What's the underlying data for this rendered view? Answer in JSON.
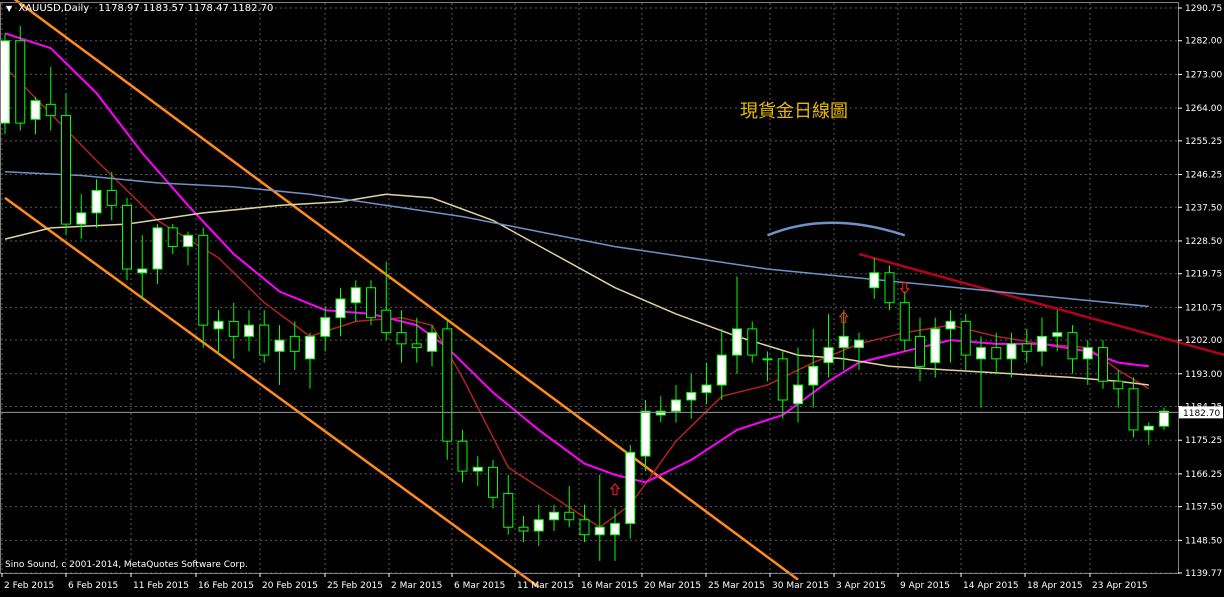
{
  "header": {
    "symbol": "XAUUSD,Daily",
    "ohlc": "1178.97 1183.57 1178.47 1182.70"
  },
  "annotation_title": "現貨金日線圖",
  "copyright": "Sino Sound, c 2001-2014, MetaQuotes Software Corp.",
  "colors": {
    "background": "#000000",
    "grid": "#5a5a5a",
    "axis_text": "#ffffff",
    "bull_candle": "#ffffff",
    "candle_outline": "#00ff00",
    "ma_fast": "#b22222",
    "ma_mid": "#ff00ff",
    "ma_slow": "#e0d4a0",
    "ma_long": "#6f93c8",
    "channel": "#ff8c1a",
    "resistance": "#b3001b",
    "arc": "#6f93c8",
    "arrow": "#ff2020",
    "title_text": "#e6b800"
  },
  "chart_data": {
    "type": "candlestick",
    "symbol": "XAUUSD",
    "timeframe": "Daily",
    "ylim": [
      1139.77,
      1290.75
    ],
    "y_ticks": [
      "1290.75",
      "1282.00",
      "1273.00",
      "1264.00",
      "1255.25",
      "1246.25",
      "1237.50",
      "1228.50",
      "1219.75",
      "1210.75",
      "1202.00",
      "1193.00",
      "1184.25",
      "1175.25",
      "1166.25",
      "1157.50",
      "1148.50",
      "1139.77"
    ],
    "x_tick_labels": [
      "2 Feb 2015",
      "6 Feb 2015",
      "11 Feb 2015",
      "16 Feb 2015",
      "20 Feb 2015",
      "25 Feb 2015",
      "2 Mar 2015",
      "6 Mar 2015",
      "11 Mar 2015",
      "16 Mar 2015",
      "20 Mar 2015",
      "25 Mar 2015",
      "30 Mar 2015",
      "3 Apr 2015",
      "9 Apr 2015",
      "14 Apr 2015",
      "18 Apr 2015",
      "23 Apr 2015"
    ],
    "current_price": "1182.70",
    "candles": [
      {
        "o": 1260,
        "h": 1284,
        "l": 1257,
        "c": 1282
      },
      {
        "o": 1282,
        "h": 1286,
        "l": 1258,
        "c": 1260
      },
      {
        "o": 1261,
        "h": 1267,
        "l": 1257,
        "c": 1266
      },
      {
        "o": 1265,
        "h": 1275,
        "l": 1258,
        "c": 1262
      },
      {
        "o": 1262,
        "h": 1268,
        "l": 1230,
        "c": 1233
      },
      {
        "o": 1233,
        "h": 1241,
        "l": 1229,
        "c": 1236
      },
      {
        "o": 1236,
        "h": 1245,
        "l": 1232,
        "c": 1242
      },
      {
        "o": 1242,
        "h": 1247,
        "l": 1234,
        "c": 1238
      },
      {
        "o": 1238,
        "h": 1240,
        "l": 1218,
        "c": 1221
      },
      {
        "o": 1220,
        "h": 1230,
        "l": 1213,
        "c": 1221
      },
      {
        "o": 1221,
        "h": 1233,
        "l": 1217,
        "c": 1232
      },
      {
        "o": 1232,
        "h": 1233,
        "l": 1225,
        "c": 1227
      },
      {
        "o": 1227,
        "h": 1231,
        "l": 1222,
        "c": 1230
      },
      {
        "o": 1230,
        "h": 1232,
        "l": 1200,
        "c": 1206
      },
      {
        "o": 1205,
        "h": 1210,
        "l": 1198,
        "c": 1207
      },
      {
        "o": 1207,
        "h": 1212,
        "l": 1197,
        "c": 1203
      },
      {
        "o": 1203,
        "h": 1210,
        "l": 1199,
        "c": 1206
      },
      {
        "o": 1206,
        "h": 1210,
        "l": 1196,
        "c": 1198
      },
      {
        "o": 1199,
        "h": 1206,
        "l": 1190,
        "c": 1202
      },
      {
        "o": 1203,
        "h": 1207,
        "l": 1194,
        "c": 1199
      },
      {
        "o": 1197,
        "h": 1204,
        "l": 1189,
        "c": 1203
      },
      {
        "o": 1203,
        "h": 1211,
        "l": 1199,
        "c": 1208
      },
      {
        "o": 1208,
        "h": 1216,
        "l": 1203,
        "c": 1213
      },
      {
        "o": 1212,
        "h": 1218,
        "l": 1207,
        "c": 1216
      },
      {
        "o": 1216,
        "h": 1218,
        "l": 1206,
        "c": 1208
      },
      {
        "o": 1210,
        "h": 1223,
        "l": 1202,
        "c": 1204
      },
      {
        "o": 1204,
        "h": 1210,
        "l": 1196,
        "c": 1201
      },
      {
        "o": 1201,
        "h": 1208,
        "l": 1196,
        "c": 1200
      },
      {
        "o": 1199,
        "h": 1206,
        "l": 1195,
        "c": 1204
      },
      {
        "o": 1205,
        "h": 1207,
        "l": 1170,
        "c": 1175
      },
      {
        "o": 1175,
        "h": 1178,
        "l": 1164,
        "c": 1167
      },
      {
        "o": 1167,
        "h": 1171,
        "l": 1163,
        "c": 1168
      },
      {
        "o": 1168,
        "h": 1170,
        "l": 1157,
        "c": 1160
      },
      {
        "o": 1161,
        "h": 1166,
        "l": 1150,
        "c": 1152
      },
      {
        "o": 1152,
        "h": 1155,
        "l": 1148,
        "c": 1151
      },
      {
        "o": 1151,
        "h": 1158,
        "l": 1147,
        "c": 1154
      },
      {
        "o": 1154,
        "h": 1158,
        "l": 1151,
        "c": 1156
      },
      {
        "o": 1156,
        "h": 1163,
        "l": 1152,
        "c": 1154
      },
      {
        "o": 1154,
        "h": 1158,
        "l": 1148,
        "c": 1150
      },
      {
        "o": 1150,
        "h": 1166,
        "l": 1143,
        "c": 1152
      },
      {
        "o": 1150,
        "h": 1157,
        "l": 1143,
        "c": 1153
      },
      {
        "o": 1153,
        "h": 1174,
        "l": 1149,
        "c": 1172
      },
      {
        "o": 1171,
        "h": 1186,
        "l": 1167,
        "c": 1183
      },
      {
        "o": 1182,
        "h": 1187,
        "l": 1180,
        "c": 1183
      },
      {
        "o": 1183,
        "h": 1190,
        "l": 1180,
        "c": 1186
      },
      {
        "o": 1186,
        "h": 1193,
        "l": 1181,
        "c": 1188
      },
      {
        "o": 1188,
        "h": 1196,
        "l": 1185,
        "c": 1190
      },
      {
        "o": 1190,
        "h": 1205,
        "l": 1186,
        "c": 1198
      },
      {
        "o": 1198,
        "h": 1219,
        "l": 1193,
        "c": 1205
      },
      {
        "o": 1205,
        "h": 1207,
        "l": 1196,
        "c": 1198
      },
      {
        "o": 1197,
        "h": 1199,
        "l": 1191,
        "c": 1197
      },
      {
        "o": 1197,
        "h": 1199,
        "l": 1181,
        "c": 1186
      },
      {
        "o": 1185,
        "h": 1200,
        "l": 1180,
        "c": 1190
      },
      {
        "o": 1190,
        "h": 1205,
        "l": 1184,
        "c": 1195
      },
      {
        "o": 1196,
        "h": 1209,
        "l": 1192,
        "c": 1200
      },
      {
        "o": 1200,
        "h": 1210,
        "l": 1194,
        "c": 1203
      },
      {
        "o": 1200,
        "h": 1204,
        "l": 1194,
        "c": 1202
      },
      {
        "o": 1216,
        "h": 1224,
        "l": 1213,
        "c": 1220
      },
      {
        "o": 1220,
        "h": 1222,
        "l": 1210,
        "c": 1212
      },
      {
        "o": 1212,
        "h": 1215,
        "l": 1199,
        "c": 1202
      },
      {
        "o": 1203,
        "h": 1208,
        "l": 1191,
        "c": 1195
      },
      {
        "o": 1196,
        "h": 1208,
        "l": 1192,
        "c": 1205
      },
      {
        "o": 1205,
        "h": 1210,
        "l": 1196,
        "c": 1207
      },
      {
        "o": 1207,
        "h": 1209,
        "l": 1194,
        "c": 1198
      },
      {
        "o": 1197,
        "h": 1203,
        "l": 1184,
        "c": 1200
      },
      {
        "o": 1200,
        "h": 1204,
        "l": 1193,
        "c": 1197
      },
      {
        "o": 1197,
        "h": 1204,
        "l": 1192,
        "c": 1201
      },
      {
        "o": 1201,
        "h": 1205,
        "l": 1196,
        "c": 1199
      },
      {
        "o": 1199,
        "h": 1208,
        "l": 1195,
        "c": 1203
      },
      {
        "o": 1203,
        "h": 1210,
        "l": 1199,
        "c": 1204
      },
      {
        "o": 1204,
        "h": 1206,
        "l": 1193,
        "c": 1197
      },
      {
        "o": 1197,
        "h": 1202,
        "l": 1190,
        "c": 1200
      },
      {
        "o": 1200,
        "h": 1202,
        "l": 1189,
        "c": 1191
      },
      {
        "o": 1191,
        "h": 1194,
        "l": 1184,
        "c": 1189
      },
      {
        "o": 1189,
        "h": 1192,
        "l": 1176,
        "c": 1178
      },
      {
        "o": 1178,
        "h": 1180,
        "l": 1174,
        "c": 1179
      },
      {
        "o": 1179,
        "h": 1184,
        "l": 1178,
        "c": 1183
      }
    ],
    "moving_averages": [
      {
        "id": "ma-fast",
        "points": [
          [
            0,
            1275
          ],
          [
            6,
            1250
          ],
          [
            10,
            1234
          ],
          [
            14,
            1224
          ],
          [
            17,
            1212
          ],
          [
            20,
            1203
          ],
          [
            23,
            1207
          ],
          [
            26,
            1208
          ],
          [
            28,
            1206
          ],
          [
            30,
            1192
          ],
          [
            33,
            1168
          ],
          [
            36,
            1160
          ],
          [
            39,
            1152
          ],
          [
            41,
            1158
          ],
          [
            44,
            1175
          ],
          [
            47,
            1187
          ],
          [
            50,
            1190
          ],
          [
            53,
            1196
          ],
          [
            56,
            1201
          ],
          [
            59,
            1204
          ],
          [
            62,
            1206
          ],
          [
            65,
            1203
          ],
          [
            68,
            1201
          ],
          [
            71,
            1200
          ],
          [
            73,
            1194
          ],
          [
            75,
            1189
          ]
        ]
      },
      {
        "id": "ma-mid",
        "points": [
          [
            0,
            1284
          ],
          [
            3,
            1280
          ],
          [
            6,
            1268
          ],
          [
            9,
            1252
          ],
          [
            12,
            1238
          ],
          [
            15,
            1225
          ],
          [
            18,
            1215
          ],
          [
            21,
            1210
          ],
          [
            24,
            1209
          ],
          [
            27,
            1206
          ],
          [
            29,
            1200
          ],
          [
            32,
            1188
          ],
          [
            35,
            1178
          ],
          [
            38,
            1169
          ],
          [
            40,
            1166
          ],
          [
            42,
            1164
          ],
          [
            45,
            1170
          ],
          [
            48,
            1178
          ],
          [
            51,
            1182
          ],
          [
            54,
            1191
          ],
          [
            56,
            1196
          ],
          [
            59,
            1199
          ],
          [
            62,
            1202
          ],
          [
            65,
            1201
          ],
          [
            68,
            1201
          ],
          [
            71,
            1199
          ],
          [
            73,
            1196
          ],
          [
            75,
            1195
          ]
        ]
      },
      {
        "id": "ma-slow",
        "points": [
          [
            0,
            1229
          ],
          [
            3,
            1232
          ],
          [
            8,
            1233
          ],
          [
            13,
            1236
          ],
          [
            18,
            1238
          ],
          [
            22,
            1239
          ],
          [
            25,
            1241
          ],
          [
            28,
            1240
          ],
          [
            32,
            1234
          ],
          [
            36,
            1225
          ],
          [
            40,
            1216
          ],
          [
            44,
            1209
          ],
          [
            48,
            1203
          ],
          [
            52,
            1198
          ],
          [
            55,
            1197
          ],
          [
            58,
            1195
          ],
          [
            62,
            1194
          ],
          [
            66,
            1193
          ],
          [
            70,
            1192
          ],
          [
            73,
            1191
          ],
          [
            75,
            1190
          ]
        ]
      },
      {
        "id": "ma-long",
        "points": [
          [
            0,
            1247
          ],
          [
            5,
            1246
          ],
          [
            10,
            1244
          ],
          [
            15,
            1243
          ],
          [
            20,
            1241
          ],
          [
            25,
            1238
          ],
          [
            30,
            1235
          ],
          [
            35,
            1231
          ],
          [
            40,
            1227
          ],
          [
            45,
            1224
          ],
          [
            50,
            1221
          ],
          [
            55,
            1219
          ],
          [
            60,
            1217
          ],
          [
            65,
            1215
          ],
          [
            70,
            1213
          ],
          [
            75,
            1211
          ]
        ]
      }
    ],
    "trendlines": [
      {
        "id": "channel-upper",
        "x1": 0,
        "y1": 1295,
        "x2": 52,
        "y2": 1138
      },
      {
        "id": "channel-lower",
        "x1": 0,
        "y1": 1240,
        "x2": 35,
        "y2": 1136
      },
      {
        "id": "resistance",
        "x1": 56,
        "y1": 1225,
        "x2": 80,
        "y2": 1198
      }
    ],
    "arc": {
      "points": [
        [
          50,
          1230
        ],
        [
          54,
          1233
        ],
        [
          59,
          1230
        ]
      ]
    },
    "markers": [
      {
        "type": "up-arrow",
        "i": 40,
        "price": 1162
      },
      {
        "type": "up-arrow",
        "i": 55,
        "price": 1208
      },
      {
        "type": "down-arrow",
        "i": 59,
        "price": 1216
      }
    ]
  }
}
